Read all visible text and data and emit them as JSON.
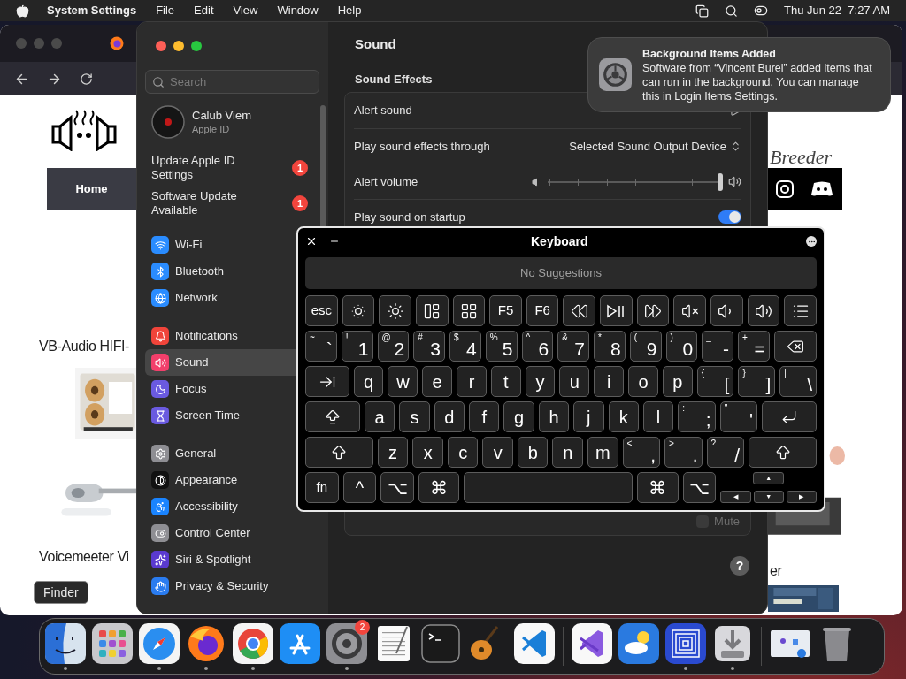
{
  "menu_bar": {
    "app": "System Settings",
    "menus": [
      "File",
      "Edit",
      "View",
      "Window",
      "Help"
    ],
    "clock": "Thu Jun 22  7:27 AM"
  },
  "browser": {
    "nav_item": "Home",
    "headings": [
      "VB-Audio HIFI-",
      "Voicemeeter Vi"
    ],
    "brand": "Breeder",
    "caption": "er"
  },
  "settings": {
    "sidebar": {
      "search": {
        "placeholder": "Search"
      },
      "account": {
        "name": "Calub Viem",
        "subtitle": "Apple ID"
      },
      "alerts": [
        {
          "text": "Update Apple ID Settings",
          "badge": "1"
        },
        {
          "text": "Software Update Available",
          "badge": "1"
        }
      ],
      "groups": [
        {
          "items": [
            {
              "label": "Wi-Fi",
              "color": "#2a8cff",
              "selected": false
            },
            {
              "label": "Bluetooth",
              "color": "#2a8cff",
              "selected": false
            },
            {
              "label": "Network",
              "color": "#2a8cff",
              "selected": false
            }
          ]
        },
        {
          "items": [
            {
              "label": "Notifications",
              "color": "#f0443a",
              "selected": false
            },
            {
              "label": "Sound",
              "color": "#f23f6b",
              "selected": true
            },
            {
              "label": "Focus",
              "color": "#6a5ae0",
              "selected": false
            },
            {
              "label": "Screen Time",
              "color": "#6a5ae0",
              "selected": false
            }
          ]
        },
        {
          "items": [
            {
              "label": "General",
              "color": "#8e8e93",
              "selected": false
            },
            {
              "label": "Appearance",
              "color": "#111111",
              "selected": false
            },
            {
              "label": "Accessibility",
              "color": "#1a84ff",
              "selected": false
            },
            {
              "label": "Control Center",
              "color": "#8e8e93",
              "selected": false
            },
            {
              "label": "Siri & Spotlight",
              "color": "#5a3ad0",
              "selected": false
            },
            {
              "label": "Privacy & Security",
              "color": "#2a7cf0",
              "selected": false
            }
          ]
        }
      ]
    },
    "content": {
      "title": "Sound",
      "section": "Sound Effects",
      "rows": [
        {
          "kind": "popup",
          "label": "Alert sound"
        },
        {
          "kind": "popup",
          "label": "Play sound effects through",
          "value": "Selected Sound Output Device"
        },
        {
          "kind": "slider",
          "label": "Alert volume",
          "level": 1
        },
        {
          "kind": "toggle",
          "label": "Play sound on startup",
          "on": true
        }
      ],
      "mute": {
        "label": "Mute",
        "checked": false
      },
      "help": "?"
    }
  },
  "notification": {
    "title": "Background Items Added",
    "body": "Software from “Vincent Burel” added items that can run in the background. You can manage this in Login Items Settings."
  },
  "keyboard": {
    "title": "Keyboard",
    "suggestions": "No Suggestions",
    "rows": [
      {
        "keys": [
          {
            "kind": "text",
            "label": "esc"
          },
          {
            "kind": "brightness-down"
          },
          {
            "kind": "brightness-up"
          },
          {
            "kind": "mission-control"
          },
          {
            "kind": "launchpad"
          },
          {
            "kind": "text",
            "label": "F5"
          },
          {
            "kind": "text",
            "label": "F6"
          },
          {
            "kind": "rewind"
          },
          {
            "kind": "play-pause"
          },
          {
            "kind": "fast-forward"
          },
          {
            "kind": "mute"
          },
          {
            "kind": "volume-down"
          },
          {
            "kind": "volume-up"
          },
          {
            "kind": "list"
          }
        ]
      },
      {
        "keys": [
          {
            "kind": "text",
            "label": "`",
            "shift": "~"
          },
          {
            "kind": "text",
            "label": "1",
            "shift": "!"
          },
          {
            "kind": "text",
            "label": "2",
            "shift": "@"
          },
          {
            "kind": "text",
            "label": "3",
            "shift": "#"
          },
          {
            "kind": "text",
            "label": "4",
            "shift": "$"
          },
          {
            "kind": "text",
            "label": "5",
            "shift": "%"
          },
          {
            "kind": "text",
            "label": "6",
            "shift": "^"
          },
          {
            "kind": "text",
            "label": "7",
            "shift": "&"
          },
          {
            "kind": "text",
            "label": "8",
            "shift": "*"
          },
          {
            "kind": "text",
            "label": "9",
            "shift": "("
          },
          {
            "kind": "text",
            "label": "0",
            "shift": ")"
          },
          {
            "kind": "text",
            "label": "-",
            "shift": "_"
          },
          {
            "kind": "text",
            "label": "=",
            "shift": "+"
          },
          {
            "kind": "delete"
          }
        ]
      },
      {
        "keys": [
          {
            "kind": "tab"
          },
          {
            "kind": "text",
            "label": "q"
          },
          {
            "kind": "text",
            "label": "w"
          },
          {
            "kind": "text",
            "label": "e"
          },
          {
            "kind": "text",
            "label": "r"
          },
          {
            "kind": "text",
            "label": "t"
          },
          {
            "kind": "text",
            "label": "y"
          },
          {
            "kind": "text",
            "label": "u"
          },
          {
            "kind": "text",
            "label": "i"
          },
          {
            "kind": "text",
            "label": "o"
          },
          {
            "kind": "text",
            "label": "p"
          },
          {
            "kind": "text",
            "label": "[",
            "shift": "{"
          },
          {
            "kind": "text",
            "label": "]",
            "shift": "}"
          },
          {
            "kind": "text",
            "label": "\\",
            "shift": "|"
          }
        ]
      },
      {
        "keys": [
          {
            "kind": "caps-lock"
          },
          {
            "kind": "text",
            "label": "a"
          },
          {
            "kind": "text",
            "label": "s"
          },
          {
            "kind": "text",
            "label": "d"
          },
          {
            "kind": "text",
            "label": "f"
          },
          {
            "kind": "text",
            "label": "g"
          },
          {
            "kind": "text",
            "label": "h"
          },
          {
            "kind": "text",
            "label": "j"
          },
          {
            "kind": "text",
            "label": "k"
          },
          {
            "kind": "text",
            "label": "l"
          },
          {
            "kind": "text",
            "label": ";",
            "shift": ":"
          },
          {
            "kind": "text",
            "label": "'",
            "shift": "\""
          },
          {
            "kind": "return"
          }
        ]
      },
      {
        "keys": [
          {
            "kind": "shift"
          },
          {
            "kind": "text",
            "label": "z"
          },
          {
            "kind": "text",
            "label": "x"
          },
          {
            "kind": "text",
            "label": "c"
          },
          {
            "kind": "text",
            "label": "v"
          },
          {
            "kind": "text",
            "label": "b"
          },
          {
            "kind": "text",
            "label": "n"
          },
          {
            "kind": "text",
            "label": "m"
          },
          {
            "kind": "text",
            "label": ",",
            "shift": "<"
          },
          {
            "kind": "text",
            "label": ".",
            "shift": ">"
          },
          {
            "kind": "text",
            "label": "/",
            "shift": "?"
          },
          {
            "kind": "shift"
          }
        ]
      },
      {
        "keys": [
          {
            "kind": "text",
            "label": "fn"
          },
          {
            "kind": "text",
            "label": "^"
          },
          {
            "kind": "text",
            "label": "⌥"
          },
          {
            "kind": "command",
            "label": "⌘"
          },
          {
            "kind": "space"
          },
          {
            "kind": "command",
            "label": "⌘"
          },
          {
            "kind": "text",
            "label": "⌥"
          },
          {
            "kind": "arrows",
            "labels": [
              "▲",
              "◀",
              "▼",
              "▶"
            ]
          }
        ]
      }
    ]
  },
  "dock_tooltip": "Finder",
  "dock": [
    {
      "kind": "app",
      "running": true
    },
    {
      "kind": "app",
      "running": false
    },
    {
      "kind": "app",
      "running": true
    },
    {
      "kind": "app",
      "running": true
    },
    {
      "kind": "app",
      "running": true
    },
    {
      "kind": "app",
      "running": false
    },
    {
      "kind": "app",
      "running": true,
      "badge": "2"
    },
    {
      "kind": "app",
      "running": false
    },
    {
      "kind": "app",
      "running": false
    },
    {
      "kind": "app",
      "running": false
    },
    {
      "kind": "app",
      "running": false
    },
    {
      "kind": "separator"
    },
    {
      "kind": "app",
      "running": false
    },
    {
      "kind": "app",
      "running": false
    },
    {
      "kind": "app",
      "running": true
    },
    {
      "kind": "app",
      "running": true
    },
    {
      "kind": "separator"
    },
    {
      "kind": "app",
      "running": false
    },
    {
      "kind": "app",
      "running": false
    }
  ]
}
